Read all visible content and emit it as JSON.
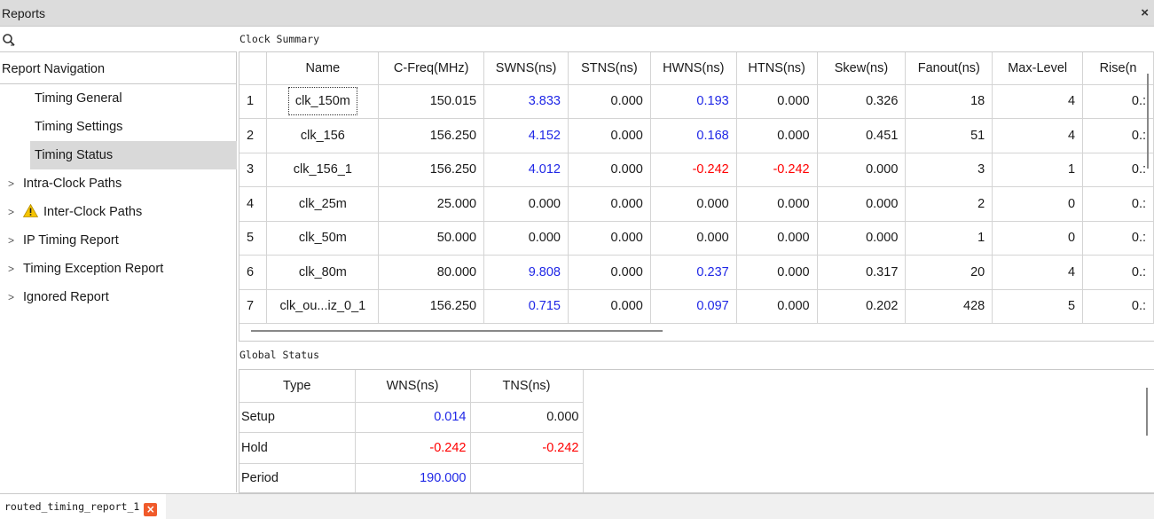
{
  "window": {
    "title": "Reports",
    "close_glyph": "×"
  },
  "search": {
    "placeholder": "",
    "value": ""
  },
  "nav": {
    "heading": "Report Navigation",
    "children": [
      {
        "label": "Timing General",
        "selected": false
      },
      {
        "label": "Timing Settings",
        "selected": false
      },
      {
        "label": "Timing Status",
        "selected": true
      }
    ],
    "groups": [
      {
        "label": "Intra-Clock Paths",
        "warning": false
      },
      {
        "label": "Inter-Clock Paths",
        "warning": true
      },
      {
        "label": "IP Timing Report",
        "warning": false
      },
      {
        "label": "Timing Exception Report",
        "warning": false
      },
      {
        "label": "Ignored Report",
        "warning": false
      }
    ]
  },
  "clock_summary": {
    "label": "Clock Summary",
    "columns": [
      "",
      "Name",
      "C-Freq(MHz)",
      "SWNS(ns)",
      "STNS(ns)",
      "HWNS(ns)",
      "HTNS(ns)",
      "Skew(ns)",
      "Fanout(ns)",
      "Max-Level",
      "Rise(n"
    ],
    "rows": [
      [
        "1",
        "clk_150m",
        "150.015",
        "3.833",
        "0.000",
        "0.193",
        "0.000",
        "0.326",
        "18",
        "4",
        "0.:"
      ],
      [
        "2",
        "clk_156",
        "156.250",
        "4.152",
        "0.000",
        "0.168",
        "0.000",
        "0.451",
        "51",
        "4",
        "0.:"
      ],
      [
        "3",
        "clk_156_1",
        "156.250",
        "4.012",
        "0.000",
        "-0.242",
        "-0.242",
        "0.000",
        "3",
        "1",
        "0.:"
      ],
      [
        "4",
        "clk_25m",
        "25.000",
        "0.000",
        "0.000",
        "0.000",
        "0.000",
        "0.000",
        "2",
        "0",
        "0.:"
      ],
      [
        "5",
        "clk_50m",
        "50.000",
        "0.000",
        "0.000",
        "0.000",
        "0.000",
        "0.000",
        "1",
        "0",
        "0.:"
      ],
      [
        "6",
        "clk_80m",
        "80.000",
        "9.808",
        "0.000",
        "0.237",
        "0.000",
        "0.317",
        "20",
        "4",
        "0.:"
      ],
      [
        "7",
        "clk_ou...iz_0_1",
        "156.250",
        "0.715",
        "0.000",
        "0.097",
        "0.000",
        "0.202",
        "428",
        "5",
        "0.:"
      ]
    ]
  },
  "global_status": {
    "label": "Global Status",
    "columns": [
      "Type",
      "WNS(ns)",
      "TNS(ns)"
    ],
    "rows": [
      [
        "Setup",
        "0.014",
        "0.000"
      ],
      [
        "Hold",
        "-0.242",
        "-0.242"
      ],
      [
        "Period",
        "190.000",
        ""
      ]
    ]
  },
  "bottom_tab": {
    "label": "routed_timing_report_1",
    "close_glyph": "×"
  },
  "colors": {
    "positive_value": "#1f27e6",
    "negative_value": "#ff0000",
    "selection": "#d9d9d9",
    "tab_close": "#f05a2a"
  }
}
